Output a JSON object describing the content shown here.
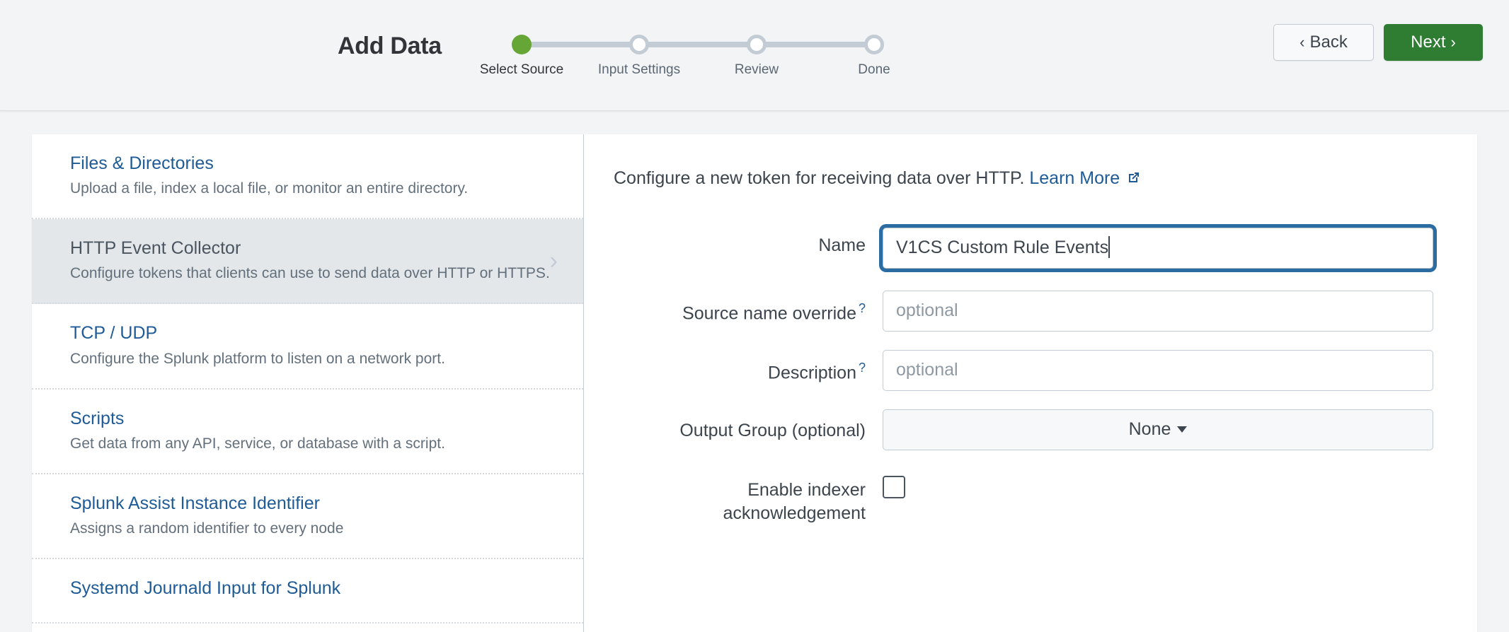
{
  "header": {
    "title": "Add Data",
    "steps": [
      {
        "label": "Select Source",
        "state": "done"
      },
      {
        "label": "Input Settings",
        "state": "todo"
      },
      {
        "label": "Review",
        "state": "todo"
      },
      {
        "label": "Done",
        "state": "todo"
      }
    ],
    "back_label": "Back",
    "back_chevron": "‹",
    "next_label": "Next",
    "next_chevron": "›",
    "accent_green": "#65a637",
    "next_button_green": "#2e7d32",
    "link_blue": "#1f5b96",
    "focus_blue": "#2b6ca3"
  },
  "sidebar": {
    "items": [
      {
        "title": "Files & Directories",
        "desc": "Upload a file, index a local file, or monitor an entire directory.",
        "selected": false
      },
      {
        "title": "HTTP Event Collector",
        "desc": "Configure tokens that clients can use to send data over HTTP or HTTPS.",
        "selected": true,
        "arrow": "›"
      },
      {
        "title": "TCP / UDP",
        "desc": "Configure the Splunk platform to listen on a network port.",
        "selected": false
      },
      {
        "title": "Scripts",
        "desc": "Get data from any API, service, or database with a script.",
        "selected": false
      },
      {
        "title": "Splunk Assist Instance Identifier",
        "desc": "Assigns a random identifier to every node",
        "selected": false
      },
      {
        "title": "Systemd Journald Input for Splunk",
        "desc": "",
        "selected": false
      }
    ]
  },
  "form": {
    "intro_text": "Configure a new token for receiving data over HTTP.",
    "intro_link": "Learn More",
    "fields": {
      "name": {
        "label": "Name",
        "value": "V1CS Custom Rule Events",
        "placeholder": ""
      },
      "source_name_override": {
        "label": "Source name override",
        "help": "?",
        "value": "",
        "placeholder": "optional"
      },
      "description": {
        "label": "Description",
        "help": "?",
        "value": "",
        "placeholder": "optional"
      },
      "output_group": {
        "label": "Output Group (optional)",
        "value": "None"
      },
      "indexer_ack": {
        "label": "Enable indexer acknowledgement",
        "checked": false
      }
    }
  }
}
